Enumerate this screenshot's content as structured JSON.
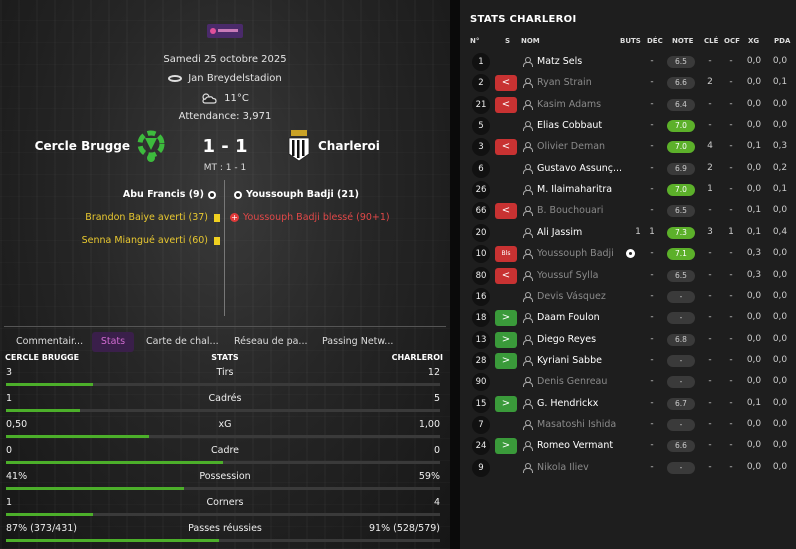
{
  "match": {
    "date": "Samedi 25 octobre 2025",
    "stadium": "Jan Breydelstadion",
    "weather": "11°C",
    "attendance": "Attendance: 3,971",
    "home_team": "Cercle Brugge",
    "away_team": "Charleroi",
    "score": "1 - 1",
    "half_time": "MT : 1 - 1"
  },
  "events": {
    "home_goal": "Abu Francis (9)",
    "away_goal": "Youssouph Badji (21)",
    "home_card_1": "Brandon Baiye averti (37)",
    "home_card_2": "Senna Miangué averti (60)",
    "away_injury": "Youssouph Badji blessé (90+1)"
  },
  "tabs": [
    "Commentair...",
    "Stats",
    "Carte de chal...",
    "Réseau de pa...",
    "Passing Netw..."
  ],
  "stats_header": {
    "home": "CERCLE BRUGGE",
    "mid": "STATS",
    "away": "CHARLEROI"
  },
  "stats": [
    {
      "name": "Tirs",
      "home": "3",
      "away": "12",
      "home_share": 0.2
    },
    {
      "name": "Cadrés",
      "home": "1",
      "away": "5",
      "home_share": 0.17
    },
    {
      "name": "xG",
      "home": "0,50",
      "away": "1,00",
      "home_share": 0.33
    },
    {
      "name": "Cadre",
      "home": "0",
      "away": "0",
      "home_share": 0.5
    },
    {
      "name": "Possession",
      "home": "41%",
      "away": "59%",
      "home_share": 0.41
    },
    {
      "name": "Corners",
      "home": "1",
      "away": "4",
      "home_share": 0.2
    },
    {
      "name": "Passes réussies",
      "home": "87% (373/431)",
      "away": "91% (528/579)",
      "home_share": 0.49
    }
  ],
  "right_title": "STATS CHARLEROI",
  "columns": [
    "N°",
    "S",
    "NOM",
    "BUTS",
    "DÉC",
    "NOTE",
    "CLÉ",
    "OCF",
    "XG",
    "PDA"
  ],
  "players": [
    {
      "num": "1",
      "sub": "",
      "name": "Matz Sels",
      "dim": false,
      "buts": "",
      "dec": "-",
      "note": "6.5",
      "good": false,
      "cle": "-",
      "ocf": "-",
      "xg": "0,0",
      "pda": "0,0"
    },
    {
      "num": "2",
      "sub": "out",
      "name": "Ryan Strain",
      "dim": true,
      "buts": "",
      "dec": "-",
      "note": "6.6",
      "good": false,
      "cle": "2",
      "ocf": "-",
      "xg": "0,0",
      "pda": "0,1"
    },
    {
      "num": "21",
      "sub": "out",
      "name": "Kasim Adams",
      "dim": true,
      "buts": "",
      "dec": "-",
      "note": "6.4",
      "good": false,
      "cle": "-",
      "ocf": "-",
      "xg": "0,0",
      "pda": "0,0"
    },
    {
      "num": "5",
      "sub": "",
      "name": "Elias Cobbaut",
      "dim": false,
      "buts": "",
      "dec": "-",
      "note": "7.0",
      "good": true,
      "cle": "-",
      "ocf": "-",
      "xg": "0,0",
      "pda": "0,0"
    },
    {
      "num": "3",
      "sub": "out",
      "name": "Olivier Deman",
      "dim": true,
      "buts": "",
      "dec": "-",
      "note": "7.0",
      "good": true,
      "cle": "4",
      "ocf": "-",
      "xg": "0,1",
      "pda": "0,3"
    },
    {
      "num": "6",
      "sub": "",
      "name": "Gustavo Assunç...",
      "dim": false,
      "buts": "",
      "dec": "-",
      "note": "6.9",
      "good": false,
      "cle": "2",
      "ocf": "-",
      "xg": "0,0",
      "pda": "0,2"
    },
    {
      "num": "26",
      "sub": "",
      "name": "M. Ilaimaharitra",
      "dim": false,
      "buts": "",
      "dec": "-",
      "note": "7.0",
      "good": true,
      "cle": "1",
      "ocf": "-",
      "xg": "0,0",
      "pda": "0,1"
    },
    {
      "num": "66",
      "sub": "out",
      "name": "B. Bouchouari",
      "dim": true,
      "buts": "",
      "dec": "-",
      "note": "6.5",
      "good": false,
      "cle": "-",
      "ocf": "-",
      "xg": "0,1",
      "pda": "0,0"
    },
    {
      "num": "20",
      "sub": "",
      "name": "Ali Jassim",
      "dim": false,
      "buts": "1",
      "dec": "1",
      "note": "7.3",
      "good": true,
      "cle": "3",
      "ocf": "1",
      "xg": "0,1",
      "pda": "0,4"
    },
    {
      "num": "10",
      "sub": "bls",
      "name": "Youssouph Badji",
      "dim": true,
      "goal": true,
      "buts": "",
      "dec": "-",
      "note": "7.1",
      "good": true,
      "cle": "-",
      "ocf": "-",
      "xg": "0,3",
      "pda": "0,0"
    },
    {
      "num": "80",
      "sub": "out",
      "name": "Youssuf Sylla",
      "dim": true,
      "buts": "",
      "dec": "-",
      "note": "6.5",
      "good": false,
      "cle": "-",
      "ocf": "-",
      "xg": "0,3",
      "pda": "0,0"
    },
    {
      "num": "16",
      "sub": "",
      "name": "Devis Vásquez",
      "dim": true,
      "buts": "",
      "dec": "-",
      "note": "-",
      "good": false,
      "cle": "-",
      "ocf": "-",
      "xg": "0,0",
      "pda": "0,0"
    },
    {
      "num": "18",
      "sub": "in",
      "name": "Daam Foulon",
      "dim": false,
      "buts": "",
      "dec": "-",
      "note": "-",
      "good": false,
      "cle": "-",
      "ocf": "-",
      "xg": "0,0",
      "pda": "0,0"
    },
    {
      "num": "13",
      "sub": "in",
      "name": "Diego Reyes",
      "dim": false,
      "buts": "",
      "dec": "-",
      "note": "6.8",
      "good": false,
      "cle": "-",
      "ocf": "-",
      "xg": "0,0",
      "pda": "0,0"
    },
    {
      "num": "28",
      "sub": "in",
      "name": "Kyriani Sabbe",
      "dim": false,
      "buts": "",
      "dec": "-",
      "note": "-",
      "good": false,
      "cle": "-",
      "ocf": "-",
      "xg": "0,0",
      "pda": "0,0"
    },
    {
      "num": "90",
      "sub": "",
      "name": "Denis Genreau",
      "dim": true,
      "buts": "",
      "dec": "-",
      "note": "-",
      "good": false,
      "cle": "-",
      "ocf": "-",
      "xg": "0,0",
      "pda": "0,0"
    },
    {
      "num": "15",
      "sub": "in",
      "name": "G. Hendrickx",
      "dim": false,
      "buts": "",
      "dec": "-",
      "note": "6.7",
      "good": false,
      "cle": "-",
      "ocf": "-",
      "xg": "0,1",
      "pda": "0,0"
    },
    {
      "num": "7",
      "sub": "",
      "name": "Masatoshi Ishida",
      "dim": true,
      "buts": "",
      "dec": "-",
      "note": "-",
      "good": false,
      "cle": "-",
      "ocf": "-",
      "xg": "0,0",
      "pda": "0,0"
    },
    {
      "num": "24",
      "sub": "in",
      "name": "Romeo Vermant",
      "dim": false,
      "buts": "",
      "dec": "-",
      "note": "6.6",
      "good": false,
      "cle": "-",
      "ocf": "-",
      "xg": "0,0",
      "pda": "0,0"
    },
    {
      "num": "9",
      "sub": "",
      "name": "Nikola Iliev",
      "dim": true,
      "buts": "",
      "dec": "-",
      "note": "-",
      "good": false,
      "cle": "-",
      "ocf": "-",
      "xg": "0,0",
      "pda": "0,0"
    }
  ],
  "sub_labels": {
    "out": "<",
    "in": ">",
    "bls": "Bls"
  },
  "colors": {
    "accent": "#d06bd0",
    "good": "#5cb02a",
    "bar": "#4caf2a",
    "out": "#c83232",
    "in": "#3a9a3a"
  }
}
